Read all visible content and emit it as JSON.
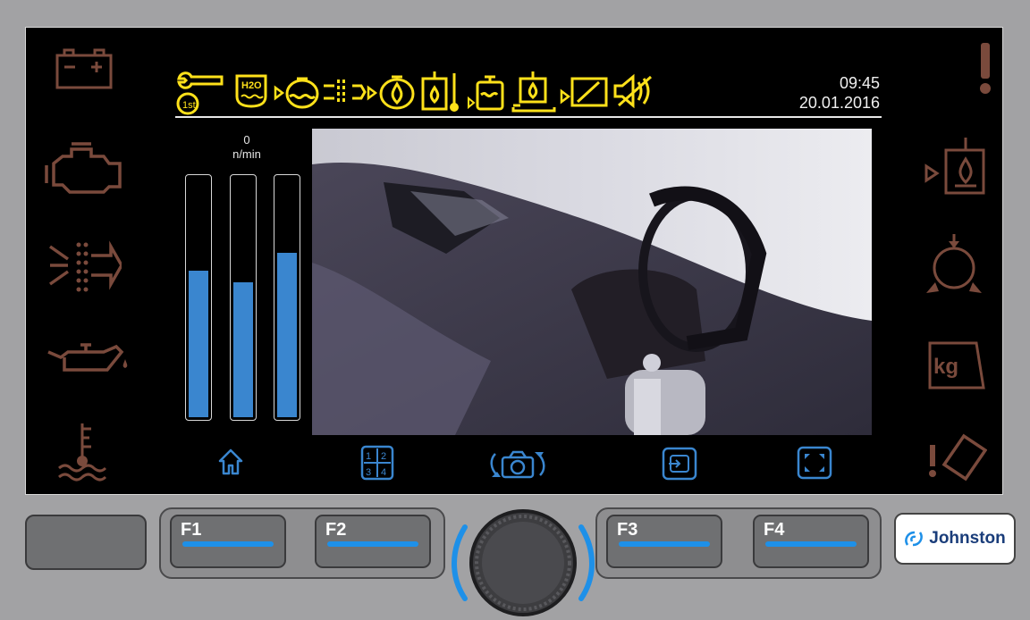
{
  "status": {
    "time": "09:45",
    "date": "20.01.2016"
  },
  "gauges": {
    "rpm_value": "0",
    "rpm_unit": "n/min",
    "levels": [
      0.6,
      0.55,
      0.67
    ],
    "color": "#3a86cf"
  },
  "left_warning_icons": [
    "battery-icon",
    "engine-icon",
    "air-filter-icon",
    "oil-pressure-icon",
    "coolant-temperature-icon"
  ],
  "right_warning_icons": [
    "warning-exclamation-icon",
    "hydraulic-oil-icon",
    "pump-icon",
    "weight-kg-icon",
    "tilt-warning-icon"
  ],
  "right_weight_label": "kg",
  "status_icons": [
    "service-1st-icon",
    "water-tank-icon",
    "water-level-icon",
    "fan-icon",
    "oil-tank-icon",
    "oil-temperature-icon",
    "fuel-level-icon",
    "hopper-level-icon",
    "brush-angle-icon",
    "mute-icon"
  ],
  "service_label": "1st",
  "water_label": "H2O",
  "softkey_icons": [
    "home-icon",
    "split-view-icon",
    "camera-switch-icon",
    "screen-source-icon",
    "fullscreen-icon"
  ],
  "split_view_labels": [
    "1",
    "2",
    "3",
    "4"
  ],
  "function_keys": [
    {
      "label": "F1"
    },
    {
      "label": "F2"
    },
    {
      "label": "F3"
    },
    {
      "label": "F4"
    }
  ],
  "brand": {
    "name": "Johnston"
  },
  "colors": {
    "warning_off": "#7a4a3c",
    "status_yellow": "#ffe11a",
    "accent_blue": "#3a86cf",
    "key_led": "#1e90e8"
  }
}
